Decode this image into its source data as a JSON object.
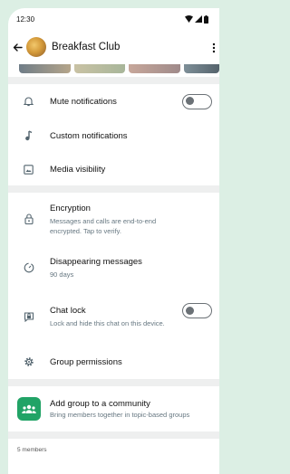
{
  "status": {
    "time": "12:30"
  },
  "header": {
    "title": "Breakfast Club"
  },
  "settings": {
    "mute": "Mute notifications",
    "custom": "Custom notifications",
    "media": "Media visibility"
  },
  "privacy": {
    "encryption_title": "Encryption",
    "encryption_sub": "Messages and calls are end-to-end encrypted. Tap to verify.",
    "disappearing_title": "Disappearing messages",
    "disappearing_sub": "90 days",
    "chatlock_title": "Chat lock",
    "chatlock_sub": "Lock and hide this chat on this device.",
    "permissions": "Group permissions"
  },
  "community": {
    "title": "Add group to a community",
    "sub": "Bring members together in topic-based groups"
  },
  "members": {
    "count": "5 members"
  },
  "toggles": {
    "mute_on": false,
    "chat_lock_on": false
  },
  "colors": {
    "accent": "#21a366",
    "divider": "#eeefef",
    "secondary_text": "#667781"
  }
}
